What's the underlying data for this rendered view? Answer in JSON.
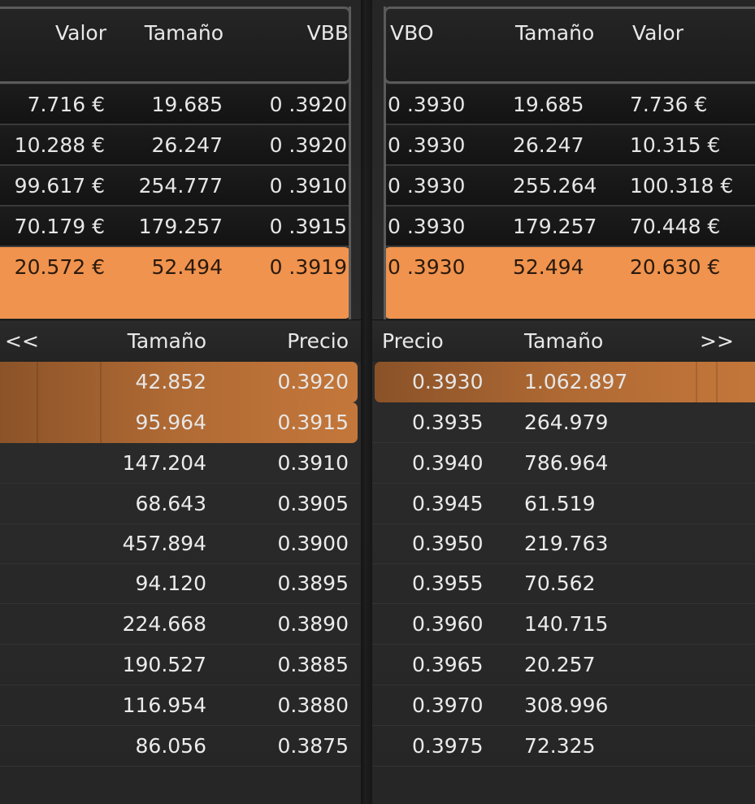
{
  "buy_trades": {
    "headers": {
      "valor": "Valor",
      "tamano": "Tamaño",
      "vbb": "VBB"
    },
    "rows": [
      {
        "valor": "7.716 €",
        "tamano": "19.685",
        "vbb": "0 .3920"
      },
      {
        "valor": "10.288 €",
        "tamano": "26.247",
        "vbb": "0 .3920"
      },
      {
        "valor": "99.617 €",
        "tamano": "254.777",
        "vbb": "0 .3910"
      },
      {
        "valor": "70.179 €",
        "tamano": "179.257",
        "vbb": "0 .3915"
      },
      {
        "valor": "20.572 €",
        "tamano": "52.494",
        "vbb": "0 .3919"
      }
    ]
  },
  "sell_trades": {
    "headers": {
      "vbo": "VBO",
      "tamano": "Tamaño",
      "valor": "Valor"
    },
    "rows": [
      {
        "vbo": "0 .3930",
        "tamano": "19.685",
        "valor": "7.736 €"
      },
      {
        "vbo": "0 .3930",
        "tamano": "26.247",
        "valor": "10.315 €"
      },
      {
        "vbo": "0 .3930",
        "tamano": "255.264",
        "valor": "100.318 €"
      },
      {
        "vbo": "0 .3930",
        "tamano": "179.257",
        "valor": "70.448 €"
      },
      {
        "vbo": "0 .3930",
        "tamano": "52.494",
        "valor": "20.630 €"
      }
    ]
  },
  "bid_book": {
    "headers": {
      "nav": "<<",
      "tamano": "Tamaño",
      "precio": "Precio"
    },
    "rows": [
      {
        "tamano": "42.852",
        "precio": "0.3920"
      },
      {
        "tamano": "95.964",
        "precio": "0.3915"
      },
      {
        "tamano": "147.204",
        "precio": "0.3910"
      },
      {
        "tamano": "68.643",
        "precio": "0.3905"
      },
      {
        "tamano": "457.894",
        "precio": "0.3900"
      },
      {
        "tamano": "94.120",
        "precio": "0.3895"
      },
      {
        "tamano": "224.668",
        "precio": "0.3890"
      },
      {
        "tamano": "190.527",
        "precio": "0.3885"
      },
      {
        "tamano": "116.954",
        "precio": "0.3880"
      },
      {
        "tamano": "86.056",
        "precio": "0.3875"
      }
    ]
  },
  "ask_book": {
    "headers": {
      "precio": "Precio",
      "tamano": "Tamaño",
      "nav": ">>"
    },
    "rows": [
      {
        "precio": "0.3930",
        "tamano": "1.062.897"
      },
      {
        "precio": "0.3935",
        "tamano": "264.979"
      },
      {
        "precio": "0.3940",
        "tamano": "786.964"
      },
      {
        "precio": "0.3945",
        "tamano": "61.519"
      },
      {
        "precio": "0.3950",
        "tamano": "219.763"
      },
      {
        "precio": "0.3955",
        "tamano": "70.562"
      },
      {
        "precio": "0.3960",
        "tamano": "140.715"
      },
      {
        "precio": "0.3965",
        "tamano": "20.257"
      },
      {
        "precio": "0.3970",
        "tamano": "308.996"
      },
      {
        "precio": "0.3975",
        "tamano": "72.325"
      }
    ]
  },
  "colors": {
    "highlight": "#f0934e",
    "book_highlight": "#b06a34",
    "background": "#262626"
  }
}
